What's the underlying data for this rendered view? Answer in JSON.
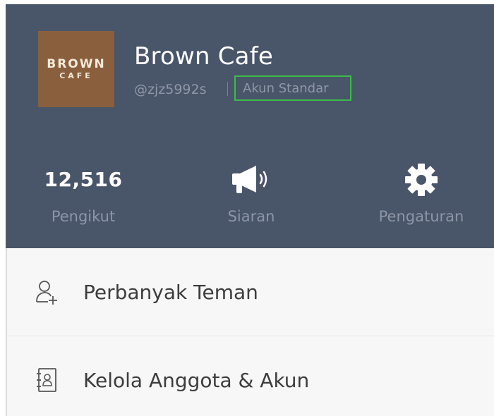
{
  "profile": {
    "logo_line1": "BROWN",
    "logo_line2": "CAFE",
    "name": "Brown Cafe",
    "handle": "@zjz5992s",
    "account_type": "Akun Standar"
  },
  "stats": [
    {
      "value": "12,516",
      "label": "Pengikut"
    },
    {
      "label": "Siaran",
      "icon": "megaphone-icon"
    },
    {
      "label": "Pengaturan",
      "icon": "gear-icon"
    }
  ],
  "menu": [
    {
      "label": "Perbanyak Teman",
      "icon": "add-friend-icon"
    },
    {
      "label": "Kelola Anggota & Akun",
      "icon": "contact-book-icon"
    }
  ],
  "colors": {
    "header_bg": "#495569",
    "logo_bg": "#8a5f3e",
    "highlight_border": "#3dba4c",
    "list_bg": "#f7f7f7"
  }
}
